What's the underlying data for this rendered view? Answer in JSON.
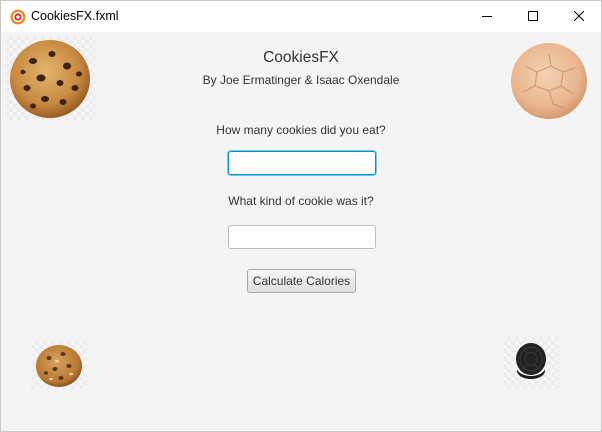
{
  "window": {
    "title": "CookiesFX.fxml",
    "accent": "#0096c9"
  },
  "header": {
    "title": "CookiesFX",
    "authors": "By Joe Ermatinger & Isaac Oxendale"
  },
  "form": {
    "count_label": "How many cookies did you eat?",
    "count_value": "",
    "kind_label": "What kind of cookie was it?",
    "kind_value": "",
    "calculate_label": "Calculate Calories"
  },
  "images": [
    {
      "name": "chocolate-chip-cookie-image"
    },
    {
      "name": "sugar-cookie-image"
    },
    {
      "name": "oatmeal-cookie-image"
    },
    {
      "name": "oreo-cookie-image"
    }
  ]
}
